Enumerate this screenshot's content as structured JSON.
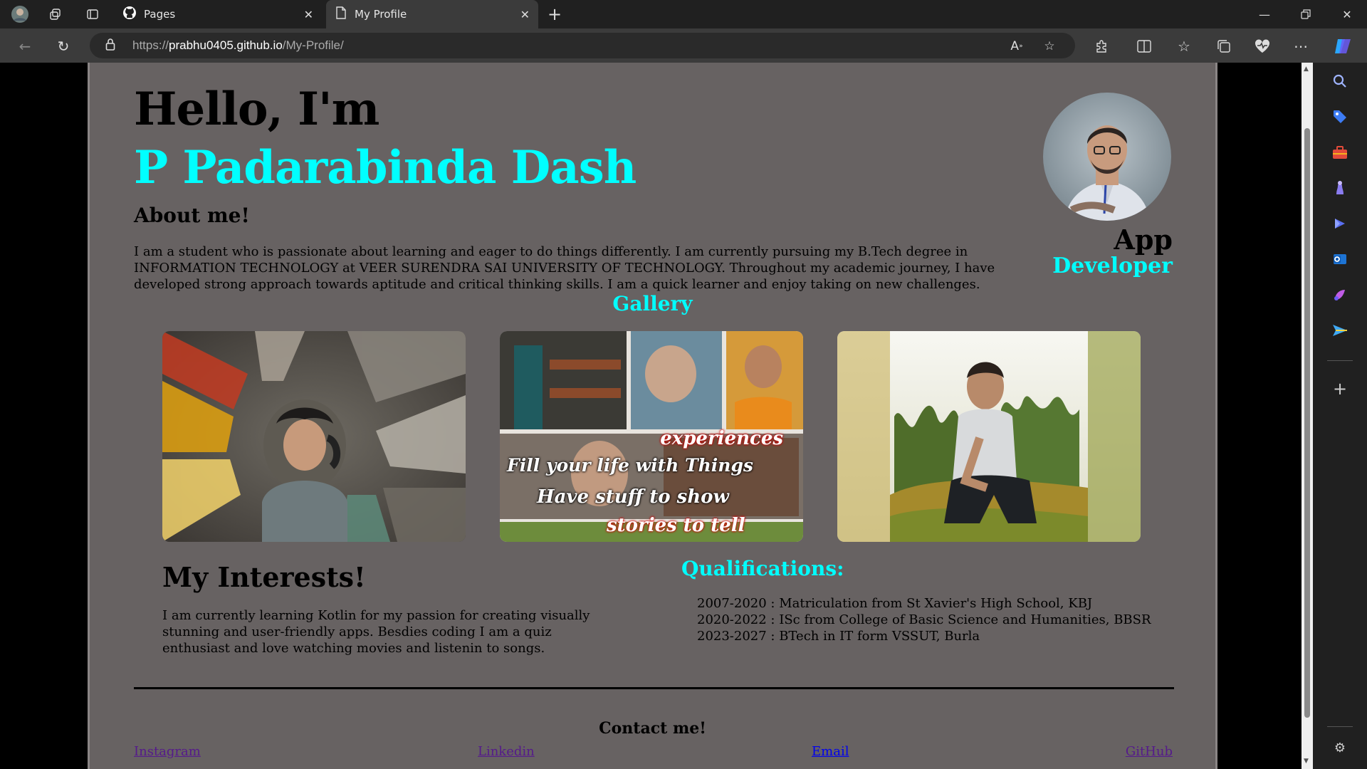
{
  "browser": {
    "tabs": [
      {
        "title": "Pages",
        "icon": "github-icon"
      },
      {
        "title": "My Profile",
        "icon": "page-icon"
      }
    ],
    "url": {
      "scheme": "https://",
      "host": "prabhu0405.github.io",
      "path": "/My-Profile/"
    }
  },
  "page": {
    "greeting": "Hello, I'm",
    "name": "P Padarabinda Dash",
    "about_heading": "About me!",
    "about_text": "I am a student who is passionate about learning and eager to do things differently. I am currently pursuing my B.Tech degree in INFORMATION TECHNOLOGY at VEER SURENDRA SAI UNIVERSITY OF TECHNOLOGY. Throughout my academic journey, I have developed strong approach towards aptitude and critical thinking skills. I am a quick learner and enjoy taking on new challenges.",
    "role_line1": "App",
    "role_line2": "Developer",
    "gallery_heading": "Gallery",
    "gallery_collage_text": [
      "experiences",
      "Fill your life with Things",
      "Have stuff to show",
      "stories to tell"
    ],
    "interests_heading": "My Interests!",
    "interests_text": "I am currently learning Kotlin for my passion for creating visually stunning and user-friendly apps. Besdies coding I am a quiz enthusiast and love watching movies and listenin to songs.",
    "qualifications_heading": "Qualifications:",
    "qualifications": [
      "2007-2020 : Matriculation from St Xavier's High School, KBJ",
      "2020-2022 : ISc from College of Basic Science and Humanities, BBSR",
      "2023-2027 : BTech in IT form VSSUT, Burla"
    ],
    "contact_heading": "Contact me!",
    "contact_links": {
      "instagram": "Instagram",
      "linkedin": "Linkedin",
      "email": "Email",
      "github": "GitHub"
    }
  },
  "colors": {
    "page_bg": "#676262",
    "accent": "#00ffff",
    "visited_link": "#551a8b",
    "link": "#0000ee"
  }
}
